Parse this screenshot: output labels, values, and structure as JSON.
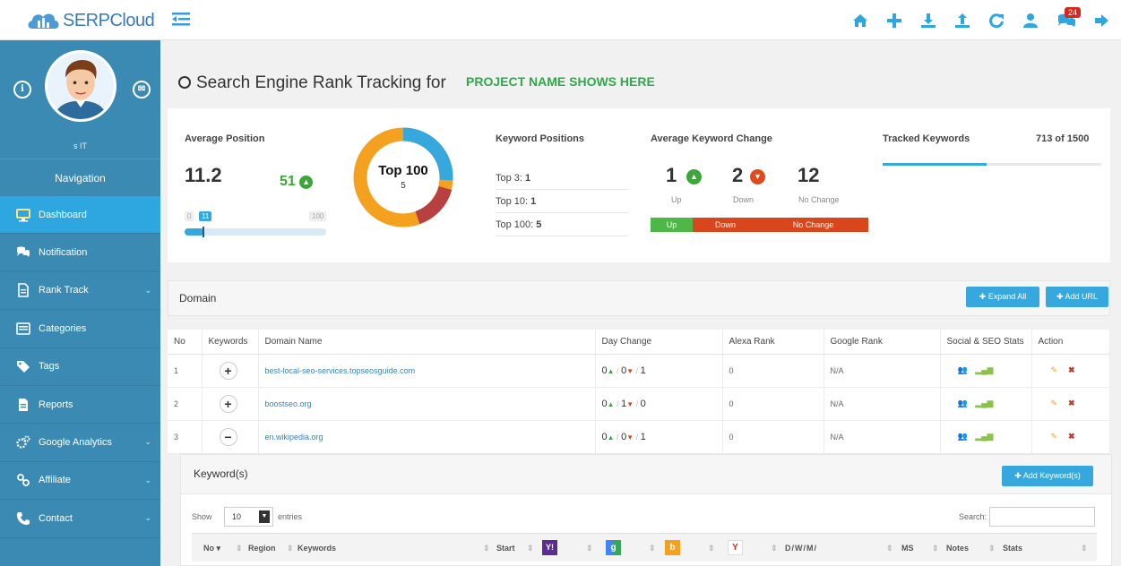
{
  "app": {
    "logo_text": "SERPCloud",
    "messages_badge": "24"
  },
  "sidebar": {
    "user_name": "s IT",
    "nav_heading": "Navigation",
    "items": [
      {
        "label": "Dashboard"
      },
      {
        "label": "Notification"
      },
      {
        "label": "Rank Track"
      },
      {
        "label": "Categories"
      },
      {
        "label": "Tags"
      },
      {
        "label": "Reports"
      },
      {
        "label": "Google Analytics"
      },
      {
        "label": "Affiliate"
      },
      {
        "label": "Contact"
      }
    ]
  },
  "page": {
    "title": "Search Engine Rank Tracking for",
    "project": "PROJECT NAME SHOWS HERE"
  },
  "stats": {
    "avg_position_label": "Average Position",
    "avg_position": "11.2",
    "avg_change": "51",
    "range_min": "0",
    "range_val": "11",
    "range_max": "100",
    "donut_title": "Top 100",
    "donut_sub": "5",
    "kp_label": "Keyword Positions",
    "kp_top3_label": "Top 3:",
    "kp_top3": "1",
    "kp_top10_label": "Top 10:",
    "kp_top10": "1",
    "kp_top100_label": "Top 100:",
    "kp_top100": "5",
    "akc_label": "Average Keyword Change",
    "up": "1",
    "up_label": "Up",
    "down": "2",
    "down_label": "Down",
    "nochange": "12",
    "nochange_label": "No Change",
    "bar_up": "Up",
    "bar_down": "Down",
    "bar_nochange": "No Change",
    "tracked_label": "Tracked Keywords",
    "tracked_value": "713 of 1500",
    "tracked_fraction": 0.475
  },
  "domain": {
    "heading": "Domain",
    "expand_all": "Expand All",
    "add_url": "Add URL",
    "columns": [
      "No",
      "Keywords",
      "Domain Name",
      "Day Change",
      "Alexa Rank",
      "Google Rank",
      "Social & SEO Stats",
      "Action"
    ],
    "rows": [
      {
        "no": "1",
        "toggle": "+",
        "domain": "best-local-seo-services.topseosguide.com",
        "up": "0",
        "down": "0",
        "same": "1",
        "alexa": "0",
        "google": "N/A"
      },
      {
        "no": "2",
        "toggle": "+",
        "domain": "boostseo.org",
        "up": "0",
        "down": "1",
        "same": "0",
        "alexa": "0",
        "google": "N/A"
      },
      {
        "no": "3",
        "toggle": "−",
        "domain": "en.wikipedia.org",
        "up": "0",
        "down": "0",
        "same": "1",
        "alexa": "0",
        "google": "N/A"
      }
    ]
  },
  "keywords": {
    "heading": "Keyword(s)",
    "add_label": "Add Keyword(s)",
    "show_label": "Show",
    "show_value": "10",
    "entries_label": "entries",
    "search_label": "Search:",
    "columns": {
      "no": "No",
      "region": "Region",
      "keywords": "Keywords",
      "start": "Start",
      "dwm": "D/W/M/",
      "ms": "MS",
      "notes": "Notes",
      "stats": "Stats"
    }
  },
  "colors": {
    "sidebar": "#3b8ab3",
    "active": "#2ea7e0",
    "accent": "#37a8de",
    "green": "#2fa94b",
    "orange": "#f4a11f",
    "red": "#d9461c"
  }
}
